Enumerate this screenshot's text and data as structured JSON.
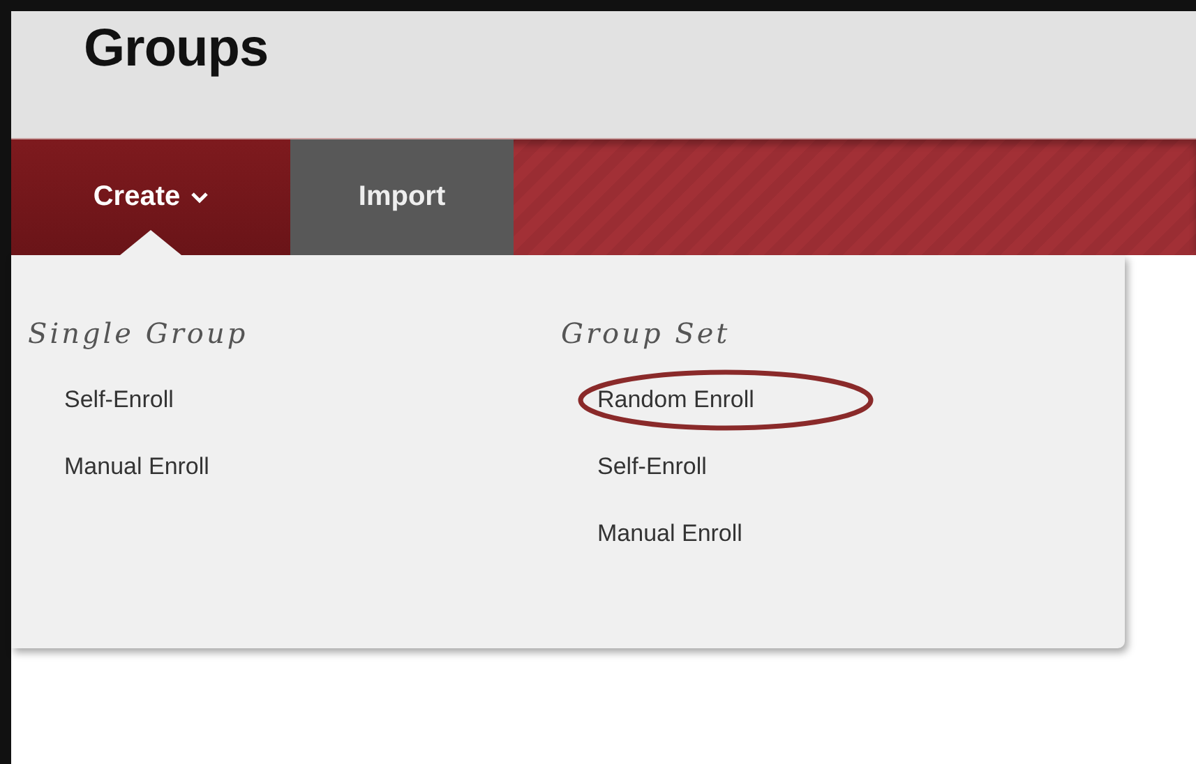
{
  "page": {
    "title": "Groups"
  },
  "tabs": [
    {
      "label": "Create",
      "selected": true,
      "has_menu": true
    },
    {
      "label": "Import",
      "selected": false,
      "has_menu": false
    }
  ],
  "menu": {
    "sections": [
      {
        "heading": "Single Group",
        "items": [
          {
            "label": "Self-Enroll",
            "circled": false
          },
          {
            "label": "Manual Enroll",
            "circled": false
          }
        ]
      },
      {
        "heading": "Group Set",
        "items": [
          {
            "label": "Random Enroll",
            "circled": true
          },
          {
            "label": "Self-Enroll",
            "circled": false
          },
          {
            "label": "Manual Enroll",
            "circled": false
          }
        ]
      }
    ]
  }
}
